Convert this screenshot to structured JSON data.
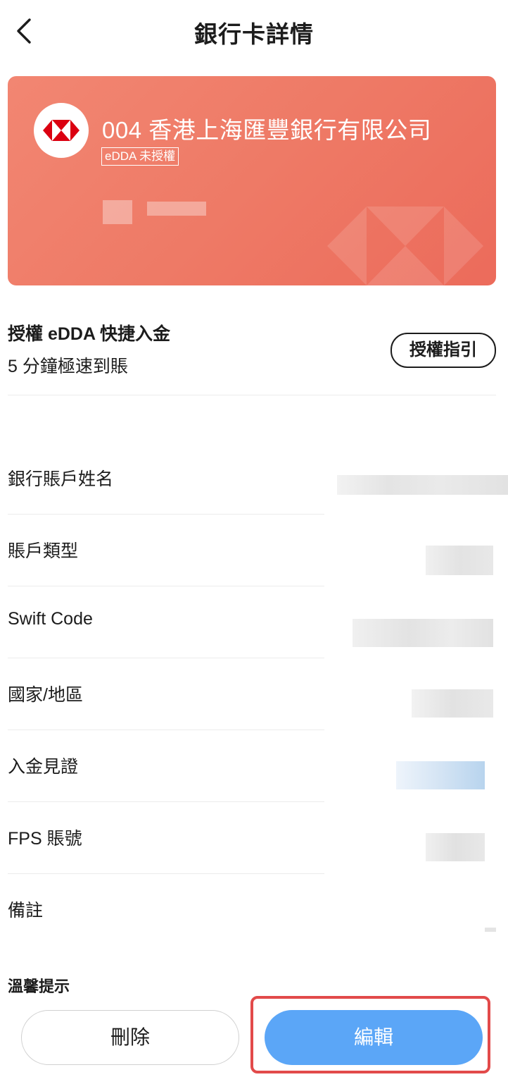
{
  "header": {
    "title": "銀行卡詳情",
    "back_icon": "chevron-left-icon"
  },
  "bank_card": {
    "name": "004 香港上海匯豐銀行有限公司",
    "badge": "eDDA 未授權",
    "logo_icon": "hsbc-logo-icon",
    "background_color": "#ee7a66"
  },
  "edda": {
    "title": "授權 eDDA 快捷入金",
    "subtitle": "5 分鐘極速到賬",
    "guide_button": "授權指引"
  },
  "details": [
    {
      "label": "銀行賬戶姓名"
    },
    {
      "label": "賬戶類型"
    },
    {
      "label": "Swift Code"
    },
    {
      "label": "國家/地區"
    },
    {
      "label": "入金見證"
    },
    {
      "label": "FPS 賬號"
    },
    {
      "label": "備註"
    }
  ],
  "tips": {
    "title": "溫馨提示"
  },
  "actions": {
    "delete_label": "刪除",
    "edit_label": "編輯",
    "edit_color": "#5ba6f7",
    "highlight_color": "#e24a4a"
  }
}
